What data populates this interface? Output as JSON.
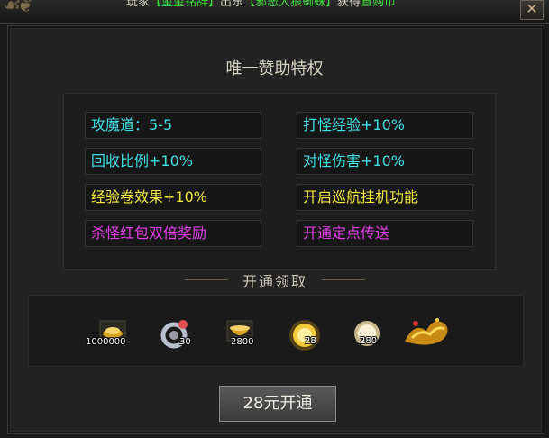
{
  "banner": {
    "segments": [
      {
        "text": "玩家",
        "color": "#d8d2c2"
      },
      {
        "text": "【玺玺铭辞】",
        "color": "#3ddc3d"
      },
      {
        "text": "出东",
        "color": "#d8d2c2"
      },
      {
        "text": "【邪恶大狼蜘蛛】",
        "color": "#3ddc3d"
      },
      {
        "text": "获得",
        "color": "#d8d2c2"
      },
      {
        "text": "直购币",
        "color": "#3ddc3d"
      }
    ],
    "close_label": "✕"
  },
  "dialog": {
    "title": "唯一赞助特权",
    "privileges": [
      {
        "text": "攻魔道：5-5",
        "color": "#3ee0e6"
      },
      {
        "text": "打怪经验+10%",
        "color": "#3ee0e6"
      },
      {
        "text": "回收比例+10%",
        "color": "#3ee0e6"
      },
      {
        "text": "对怪伤害+10%",
        "color": "#3ee0e6"
      },
      {
        "text": "经验卷效果+10%",
        "color": "#f2e93a"
      },
      {
        "text": "开启巡航挂机功能",
        "color": "#f2e93a"
      },
      {
        "text": "杀怪红包双倍奖励",
        "color": "#e23ee6"
      },
      {
        "text": "开通定点传送",
        "color": "#e23ee6"
      }
    ],
    "reward_heading": "开通领取",
    "rewards": [
      {
        "icon": "gold-ingot-icon",
        "qty": "1000000"
      },
      {
        "icon": "silver-ring-icon",
        "qty": "30"
      },
      {
        "icon": "gold-bowl-icon",
        "qty": "2800"
      },
      {
        "icon": "gold-coin-icon",
        "qty": "28"
      },
      {
        "icon": "silver-coin-icon",
        "qty": "280"
      },
      {
        "icon": "gold-dragon-icon",
        "qty": ""
      }
    ],
    "activate_label": "28元开通"
  }
}
